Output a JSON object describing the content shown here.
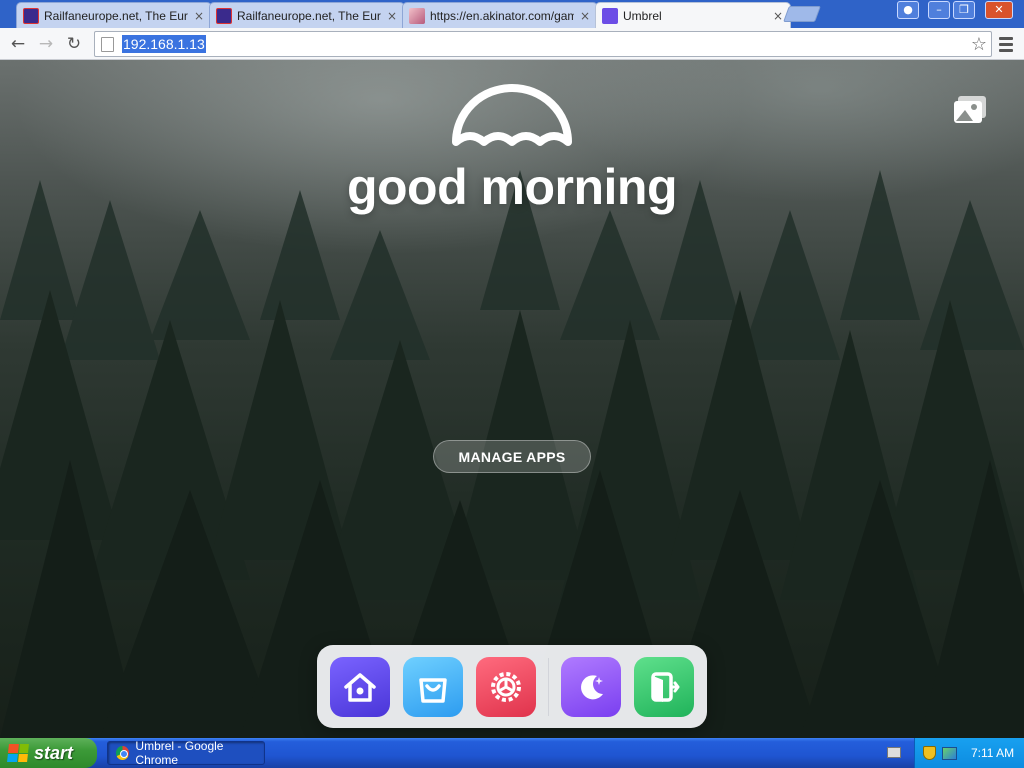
{
  "browser": {
    "tabs": [
      {
        "title": "Railfaneurope.net, The Euro",
        "favicon": "railfaneurope-favicon",
        "active": false
      },
      {
        "title": "Railfaneurope.net, The Euro",
        "favicon": "railfaneurope-favicon",
        "active": false
      },
      {
        "title": "https://en.akinator.com/gam",
        "favicon": "akinator-favicon",
        "active": false
      },
      {
        "title": "Umbrel",
        "favicon": "umbrel-favicon",
        "active": true
      }
    ],
    "close_glyph": "×",
    "address": "192.168.1.13",
    "window_controls": {
      "minimize": "–",
      "maximize": "❐",
      "close": "✕"
    }
  },
  "page": {
    "greeting": "good morning",
    "manage_apps_label": "MANAGE APPS",
    "dock": [
      {
        "name": "home",
        "icon": "home-icon"
      },
      {
        "name": "app-store",
        "icon": "shopping-bag-icon"
      },
      {
        "name": "settings",
        "icon": "settings-wheel-icon"
      },
      {
        "name": "sleep",
        "icon": "moon-icon"
      },
      {
        "name": "logout",
        "icon": "exit-door-icon"
      }
    ],
    "colors": {
      "home": "#5a45e6",
      "store": "#3fb0f5",
      "settings": "#f04a5e",
      "moon": "#8f52f6",
      "exit": "#34c46c"
    }
  },
  "taskbar": {
    "start_label": "start",
    "window_button": "Umbrel - Google Chrome",
    "clock": "7:11 AM"
  }
}
